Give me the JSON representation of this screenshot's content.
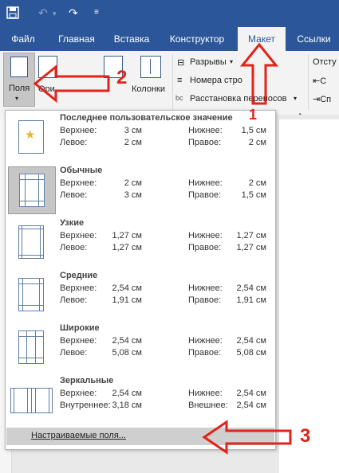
{
  "tabs": {
    "file": "Файл",
    "home": "Главная",
    "insert": "Вставка",
    "design": "Конструктор",
    "layout": "Макет",
    "references": "Ссылки"
  },
  "ribbon": {
    "margins": "Поля",
    "orientation": "Ори",
    "size": "",
    "columns": "Колонки",
    "breaks": "Разрывы",
    "line_numbers": "Номера стро",
    "hyphenation": "Расстановка переносов",
    "indent": "Отсту"
  },
  "dropdown": {
    "items": [
      {
        "title": "Последнее пользовательское значение",
        "r1": {
          "l": "Верхнее:",
          "lv": "3 см",
          "r": "Нижнее:",
          "rv": "1,5 см"
        },
        "r2": {
          "l": "Левое:",
          "lv": "2 см",
          "r": "Правое:",
          "rv": "2 см"
        }
      },
      {
        "title": "Обычные",
        "r1": {
          "l": "Верхнее:",
          "lv": "2 см",
          "r": "Нижнее:",
          "rv": "2 см"
        },
        "r2": {
          "l": "Левое:",
          "lv": "3 см",
          "r": "Правое:",
          "rv": "1,5 см"
        }
      },
      {
        "title": "Узкие",
        "r1": {
          "l": "Верхнее:",
          "lv": "1,27 см",
          "r": "Нижнее:",
          "rv": "1,27 см"
        },
        "r2": {
          "l": "Левое:",
          "lv": "1,27 см",
          "r": "Правое:",
          "rv": "1,27 см"
        }
      },
      {
        "title": "Средние",
        "r1": {
          "l": "Верхнее:",
          "lv": "2,54 см",
          "r": "Нижнее:",
          "rv": "2,54 см"
        },
        "r2": {
          "l": "Левое:",
          "lv": "1,91 см",
          "r": "Правое:",
          "rv": "1,91 см"
        }
      },
      {
        "title": "Широкие",
        "r1": {
          "l": "Верхнее:",
          "lv": "2,54 см",
          "r": "Нижнее:",
          "rv": "2,54 см"
        },
        "r2": {
          "l": "Левое:",
          "lv": "5,08 см",
          "r": "Правое:",
          "rv": "5,08 см"
        }
      },
      {
        "title": "Зеркальные",
        "r1": {
          "l": "Верхнее:",
          "lv": "2,54 см",
          "r": "Нижнее:",
          "rv": "2,54 см"
        },
        "r2": {
          "l": "Внутреннее:",
          "lv": "3,18 см",
          "r": "Внешнее:",
          "rv": "2,54 см"
        }
      }
    ],
    "custom": "Настраиваемые поля..."
  },
  "annotations": {
    "n1": "1",
    "n2": "2",
    "n3": "3",
    "color": "#e2231a"
  }
}
